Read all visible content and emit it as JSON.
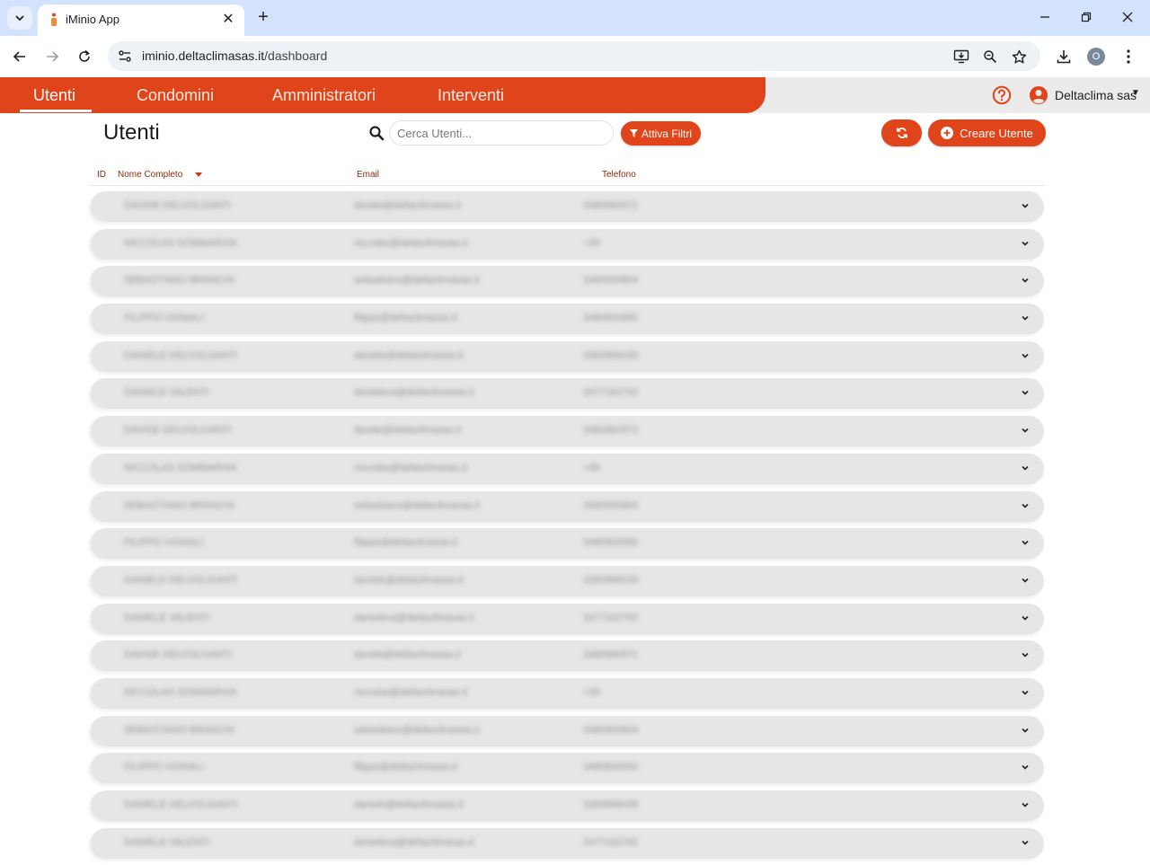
{
  "browser": {
    "tab_title": "iMinio App",
    "url_host": "iminio.deltaclimasas.it",
    "url_path": "/dashboard",
    "profile_initial": "O"
  },
  "nav": {
    "items": [
      {
        "label": "Utenti",
        "active": true
      },
      {
        "label": "Condomini",
        "active": false
      },
      {
        "label": "Amministratori",
        "active": false
      },
      {
        "label": "Interventi",
        "active": false
      }
    ],
    "user_name": "Deltaclima sas"
  },
  "page": {
    "title": "Utenti",
    "search_placeholder": "Cerca Utenti...",
    "filter_button": "Attiva Filtri",
    "create_button": "Creare Utente"
  },
  "table": {
    "headers": {
      "id": "ID",
      "name": "Nome Completo",
      "email": "Email",
      "phone": "Telefono"
    },
    "rows": [
      {
        "name": "DAVIDE DELVOLGANTI",
        "email": "davide@deltaclimasas.it",
        "phone": "3480860971"
      },
      {
        "name": "NICCOLAS SOMMARIVA",
        "email": "niccolas@deltaclimasas.it",
        "phone": "+39"
      },
      {
        "name": "SEBASTIANO BRANCHI",
        "email": "sebastiano@deltaclimasas.it",
        "phone": "3480900804"
      },
      {
        "name": "FILIPPO VIGNALI",
        "email": "filippo@deltaclimasas.it",
        "phone": "3480800990"
      },
      {
        "name": "DANIELE DELVOLGANTI",
        "email": "daniele@deltaclimasas.it",
        "phone": "3383966039"
      },
      {
        "name": "DANIELE VALENTI",
        "email": "danieleva@deltaclimasas.it",
        "phone": "3477162792"
      },
      {
        "name": "DAVIDE DELVOLGANTI",
        "email": "davide@deltaclimasas.it",
        "phone": "3480860972"
      },
      {
        "name": "NICCOLAS SOMMARIVA",
        "email": "niccolas@deltaclimasas.it",
        "phone": "+39"
      },
      {
        "name": "SEBASTIANO BRANCHI",
        "email": "sebastiano@deltaclimasas.it",
        "phone": "3480900804"
      },
      {
        "name": "FILIPPO VIGNALI",
        "email": "filippo@deltaclimasas.it",
        "phone": "3480800990"
      },
      {
        "name": "DANIELE DELVOLGANTI",
        "email": "daniele@deltaclimasas.it",
        "phone": "3383966039"
      },
      {
        "name": "DANIELE VALENTI",
        "email": "danieleva@deltaclimasas.it",
        "phone": "3477162792"
      },
      {
        "name": "DAVIDE DELVOLGANTI",
        "email": "davide@deltaclimasas.it",
        "phone": "3480860971"
      },
      {
        "name": "NICCOLAS SOMMARIVA",
        "email": "niccolas@deltaclimasas.it",
        "phone": "+39"
      },
      {
        "name": "SEBASTIANO BRANCHI",
        "email": "sebastiano@deltaclimasas.it",
        "phone": "3480900804"
      },
      {
        "name": "FILIPPO VIGNALI",
        "email": "filippo@deltaclimasas.it",
        "phone": "3480800990"
      },
      {
        "name": "DANIELE DELVOLGANTI",
        "email": "daniele@deltaclimasas.it",
        "phone": "3383966039"
      },
      {
        "name": "DANIELE VALENTI",
        "email": "danieleva@deltaclimasas.it",
        "phone": "3477162792"
      }
    ]
  },
  "colors": {
    "brand": "#e0441a",
    "header_text": "#8a2a08",
    "row_bg": "#e6e6e6"
  },
  "icons": {
    "tab_menu": "chevron-down-icon",
    "help": "help-circle-icon",
    "user": "account-circle-icon",
    "search": "search-icon",
    "filter": "filter-icon",
    "refresh": "refresh-icon",
    "create": "plus-circle-icon",
    "row_expand": "chevron-down-icon"
  }
}
